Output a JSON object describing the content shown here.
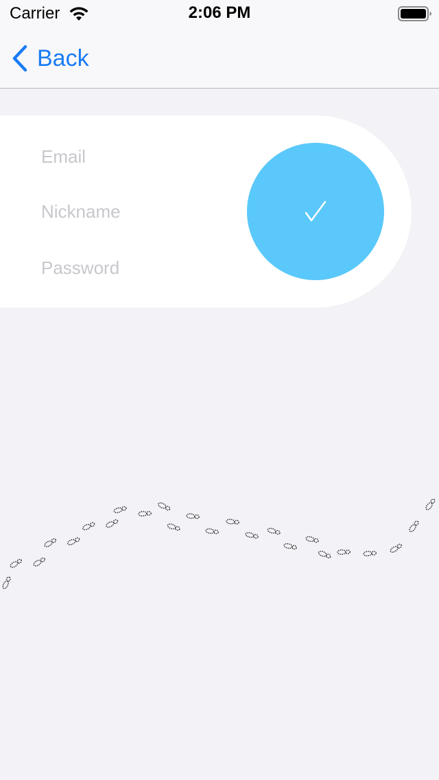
{
  "status_bar": {
    "carrier": "Carrier",
    "time": "2:06 PM"
  },
  "nav": {
    "back_label": "Back"
  },
  "form": {
    "email_placeholder": "Email",
    "nickname_placeholder": "Nickname",
    "password_placeholder": "Password",
    "submit_icon": "checkmark-icon"
  },
  "colors": {
    "accent": "#1a7cf4",
    "submit_circle": "#5ac8fa",
    "background": "#f2f2f7",
    "card": "#ffffff",
    "placeholder": "#c7c7cd"
  },
  "decoration": {
    "footsteps_icon": "footprints-trail-icon"
  }
}
